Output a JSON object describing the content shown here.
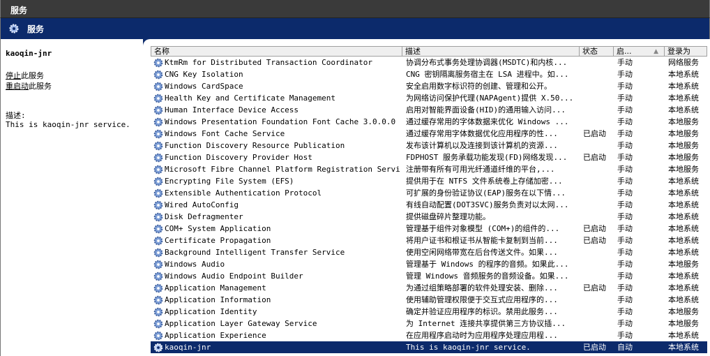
{
  "window": {
    "title": "服务"
  },
  "header": {
    "title": "服务"
  },
  "left_panel": {
    "service_name": "kaoqin-jnr",
    "stop_link": "停止",
    "stop_suffix": "此服务",
    "restart_link": "重启动",
    "restart_suffix": "此服务",
    "desc_label": "描述:",
    "desc_text": "This is kaoqin-jnr service."
  },
  "columns": {
    "name": "名称",
    "description": "描述",
    "status": "状态",
    "startup": "启...",
    "logon": "登录为"
  },
  "rows": [
    {
      "name": "KtmRm for Distributed Transaction Coordinator",
      "description": "协调分布式事务处理协调器(MSDTC)和内核...",
      "status": "",
      "startup": "手动",
      "logon": "网络服务"
    },
    {
      "name": "CNG Key Isolation",
      "description": "CNG 密钥隔离服务宿主在 LSA 进程中。如...",
      "status": "",
      "startup": "手动",
      "logon": "本地系统"
    },
    {
      "name": "Windows CardSpace",
      "description": "安全启用数字标识符的创建、管理和公开。",
      "status": "",
      "startup": "手动",
      "logon": "本地系统"
    },
    {
      "name": "Health Key and Certificate Management",
      "description": "为网络访问保护代理(NAPAgent)提供 X.50...",
      "status": "",
      "startup": "手动",
      "logon": "本地系统"
    },
    {
      "name": "Human Interface Device Access",
      "description": "启用对智能界面设备(HID)的通用输入访问...",
      "status": "",
      "startup": "手动",
      "logon": "本地系统"
    },
    {
      "name": "Windows Presentation Foundation Font Cache 3.0.0.0",
      "description": "通过缓存常用的字体数据来优化 Windows ...",
      "status": "",
      "startup": "手动",
      "logon": "本地服务"
    },
    {
      "name": "Windows Font Cache Service",
      "description": "通过缓存常用字体数据优化应用程序的性...",
      "status": "已启动",
      "startup": "手动",
      "logon": "本地服务"
    },
    {
      "name": "Function Discovery Resource Publication",
      "description": "发布该计算机以及连接到该计算机的资源...",
      "status": "",
      "startup": "手动",
      "logon": "本地服务"
    },
    {
      "name": "Function Discovery Provider Host",
      "description": "FDPHOST 服务承载功能发现(FD)网络发现...",
      "status": "已启动",
      "startup": "手动",
      "logon": "本地服务"
    },
    {
      "name": "Microsoft Fibre Channel Platform Registration Service",
      "description": "注册带有所有可用光纤通道纤维的平台,...",
      "status": "",
      "startup": "手动",
      "logon": "本地服务"
    },
    {
      "name": "Encrypting File System (EFS)",
      "description": "提供用于在 NTFS 文件系统卷上存储加密...",
      "status": "",
      "startup": "手动",
      "logon": "本地系统"
    },
    {
      "name": "Extensible Authentication Protocol",
      "description": "可扩展的身份验证协议(EAP)服务在以下情...",
      "status": "",
      "startup": "手动",
      "logon": "本地系统"
    },
    {
      "name": "Wired AutoConfig",
      "description": "有线自动配置(DOT3SVC)服务负责对以太网...",
      "status": "",
      "startup": "手动",
      "logon": "本地系统"
    },
    {
      "name": "Disk Defragmenter",
      "description": "提供磁盘碎片整理功能。",
      "status": "",
      "startup": "手动",
      "logon": "本地系统"
    },
    {
      "name": "COM+ System Application",
      "description": "管理基于组件对象模型 (COM+)的组件的...",
      "status": "已启动",
      "startup": "手动",
      "logon": "本地系统"
    },
    {
      "name": "Certificate Propagation",
      "description": "将用户证书和根证书从智能卡复制到当前...",
      "status": "已启动",
      "startup": "手动",
      "logon": "本地系统"
    },
    {
      "name": "Background Intelligent Transfer Service",
      "description": "使用空闲网络带宽在后台传送文件。如果...",
      "status": "",
      "startup": "手动",
      "logon": "本地系统"
    },
    {
      "name": "Windows Audio",
      "description": "管理基于 Windows 的程序的音频。如果此...",
      "status": "",
      "startup": "手动",
      "logon": "本地服务"
    },
    {
      "name": "Windows Audio Endpoint Builder",
      "description": "管理 Windows 音频服务的音频设备。如果...",
      "status": "",
      "startup": "手动",
      "logon": "本地系统"
    },
    {
      "name": "Application Management",
      "description": "为通过组策略部署的软件处理安装、删除...",
      "status": "已启动",
      "startup": "手动",
      "logon": "本地系统"
    },
    {
      "name": "Application Information",
      "description": "使用辅助管理权限便于交互式应用程序的...",
      "status": "",
      "startup": "手动",
      "logon": "本地系统"
    },
    {
      "name": "Application Identity",
      "description": "确定并验证应用程序的标识。禁用此服务...",
      "status": "",
      "startup": "手动",
      "logon": "本地服务"
    },
    {
      "name": "Application Layer Gateway Service",
      "description": "为 Internet 连接共享提供第三方协议插...",
      "status": "",
      "startup": "手动",
      "logon": "本地服务"
    },
    {
      "name": "Application Experience",
      "description": "在应用程序启动时为应用程序处理应用程...",
      "status": "",
      "startup": "手动",
      "logon": "本地系统"
    },
    {
      "name": "kaoqin-jnr",
      "description": "This is kaoqin-jnr service.",
      "status": "已启动",
      "startup": "自动",
      "logon": "本地系统",
      "selected": true
    }
  ],
  "colors": {
    "header_bg": "#0c2a6b",
    "titlebar_bg": "#3a3a3a",
    "selected_row": "#0c2a6b"
  },
  "icons": {
    "service": "gear-icon"
  }
}
